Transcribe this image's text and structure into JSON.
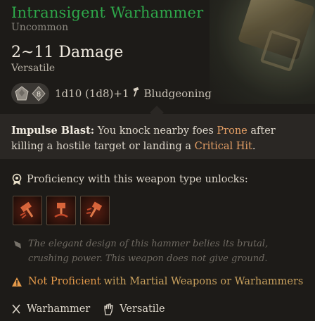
{
  "item": {
    "name": "Intransigent Warhammer",
    "rarity": "Uncommon",
    "damage": "2~11 Damage",
    "property": "Versatile",
    "dice_value": "8",
    "dice_formula": "1d10 (1d8)+1",
    "damage_type": "Bludgeoning"
  },
  "ability": {
    "name": "Impulse Blast:",
    "text_1": " You knock nearby foes ",
    "highlight_1": "Prone",
    "text_2": " after killing a hostile target or landing a ",
    "highlight_2": "Critical Hit",
    "text_3": "."
  },
  "proficiency": {
    "label": "Proficiency with this weapon type unlocks:",
    "unlock_icons": [
      "cleave-icon",
      "concussive-smash-icon",
      "rush-attack-icon"
    ]
  },
  "lore": "The elegant design of this hammer belies its brutal, crushing power. This weapon does not give ground.",
  "warning": {
    "not_proficient": "Not Proficient",
    "with_text": "with Martial Weapons or Warhammers"
  },
  "tags": {
    "weapon_type": "Warhammer",
    "property": "Versatile"
  },
  "colors": {
    "name": "#2ea84a",
    "highlight": "#e6a066",
    "warning": "#e59a4a"
  }
}
